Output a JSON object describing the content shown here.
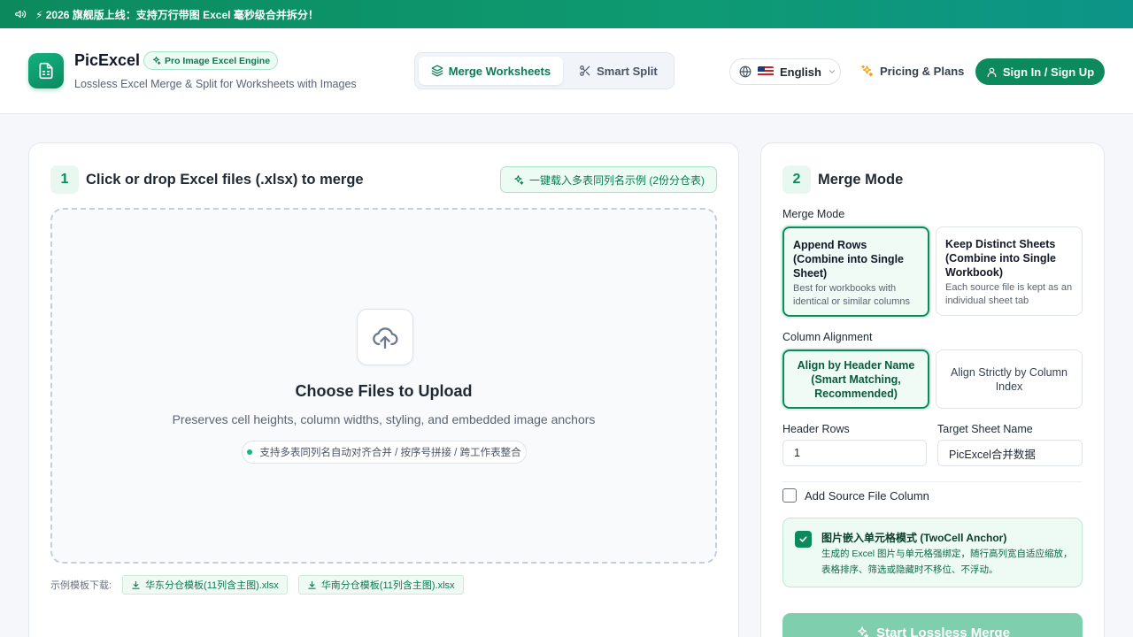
{
  "announcement": {
    "text": "⚡ 2026 旗舰版上线：支持万行带图 Excel 毫秒级合并拆分！"
  },
  "header": {
    "brand": "PicExcel",
    "badge": "Pro Image Excel Engine",
    "tagline": "Lossless Excel Merge & Split for Worksheets with Images",
    "tabs": [
      {
        "label": "Merge Worksheets",
        "active": true
      },
      {
        "label": "Smart Split",
        "active": false
      }
    ],
    "language": "English",
    "pricing": "Pricing & Plans",
    "signin": "Sign In / Sign Up"
  },
  "upload": {
    "step": "1",
    "title": "Click or drop Excel files (.xlsx) to merge",
    "sample_button": "一键载入多表同列名示例 (2份分仓表)",
    "dropzone_title": "Choose Files to Upload",
    "dropzone_subtitle": "Preserves cell heights, column widths, styling, and embedded image anchors",
    "dropzone_pill": "支持多表同列名自动对齐合并 / 按序号拼接 / 跨工作表整合",
    "downloads_label": "示例模板下载:",
    "downloads": [
      {
        "label": "华东分仓模板(11列含主图).xlsx"
      },
      {
        "label": "华南分仓模板(11列含主图).xlsx"
      }
    ]
  },
  "mode": {
    "step": "2",
    "title": "Merge Mode",
    "merge_mode_label": "Merge Mode",
    "merge_options": [
      {
        "title": "Append Rows (Combine into Single Sheet)",
        "desc": "Best for workbooks with identical or similar columns",
        "selected": true
      },
      {
        "title": "Keep Distinct Sheets (Combine into Single Workbook)",
        "desc": "Each source file is kept as an individual sheet tab",
        "selected": false
      }
    ],
    "alignment_label": "Column Alignment",
    "alignment_options": [
      {
        "label": "Align by Header Name (Smart Matching, Recommended)",
        "selected": true
      },
      {
        "label": "Align Strictly by Column Index",
        "selected": false
      }
    ],
    "header_rows_label": "Header Rows",
    "header_rows_value": "1",
    "target_sheet_label": "Target Sheet Name",
    "target_sheet_value": "PicExcel合并数据",
    "add_source_label": "Add Source File Column",
    "add_source_checked": false,
    "image_mode_title": "图片嵌入单元格模式 (TwoCell Anchor)",
    "image_mode_desc": "生成的 Excel 图片与单元格强绑定，随行高列宽自适应缩放，表格排序、筛选或隐藏时不移位、不浮动。",
    "image_mode_checked": true,
    "start_button": "Start Lossless Merge"
  },
  "colors": {
    "accent": "#0c8a5e",
    "accent_light": "#ecfbf4",
    "disabled_button": "#7fcfae"
  }
}
